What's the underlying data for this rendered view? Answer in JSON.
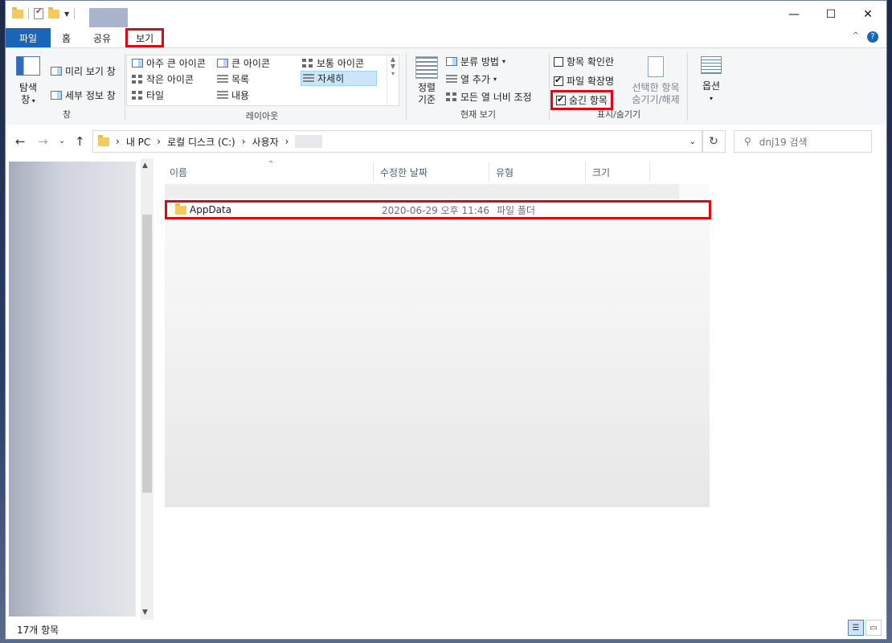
{
  "titlebar": {
    "minimize": "—",
    "maximize": "☐",
    "close": "✕"
  },
  "tabs": [
    {
      "label": "파일"
    },
    {
      "label": "홈"
    },
    {
      "label": "공유"
    },
    {
      "label": "보기"
    }
  ],
  "ribbon_right": {
    "collapse": "^",
    "help": "?"
  },
  "ribbon": {
    "pane": {
      "nav_pane": "탐색\n창",
      "preview_pane": "미리 보기 창",
      "details_pane": "세부 정보 창",
      "group_label": "창"
    },
    "layout": {
      "items": [
        "아주 큰 아이콘",
        "큰 아이콘",
        "보통 아이콘",
        "작은 아이콘",
        "목록",
        "자세히",
        "타일",
        "내용"
      ],
      "group_label": "레이아웃"
    },
    "current_view": {
      "sort_by": "정렬\n기준",
      "group_by": "분류 방법",
      "add_columns": "열 추가",
      "size_columns": "모든 열 너비 조정",
      "group_label": "현재 보기"
    },
    "show_hide": {
      "item_checkboxes": "항목 확인란",
      "file_extensions": "파일 확장명",
      "hidden_items": "숨긴 항목",
      "hide_selected": "선택한 항목\n숨기기/해제",
      "group_label": "표시/숨기기"
    },
    "options": {
      "label": "옵션"
    }
  },
  "address": {
    "crumbs": [
      "내 PC",
      "로컬 디스크 (C:)",
      "사용자"
    ],
    "search_placeholder": "dnj19 검색"
  },
  "columns": [
    "이름",
    "수정한 날짜",
    "유형",
    "크기"
  ],
  "files": [
    {
      "name": "AppData",
      "modified": "2020-06-29 오후 11:46",
      "type": "파일 폴더",
      "size": ""
    }
  ],
  "status": {
    "count": "17개 항목"
  }
}
